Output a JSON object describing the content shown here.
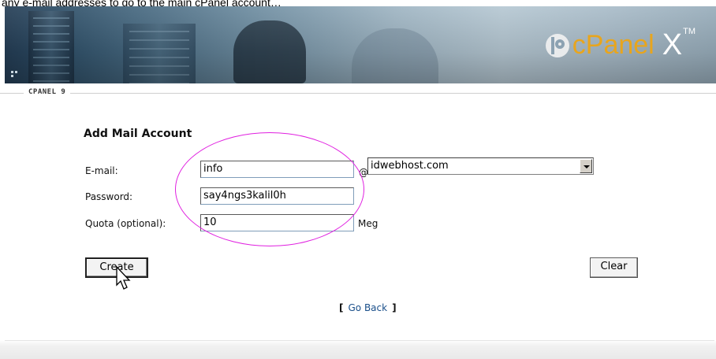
{
  "caption": "any e-mail addresses to go to the main cPanel account…",
  "banner": {
    "logo_text": "cPanel",
    "logo_suffix": "X",
    "logo_tm": "TM"
  },
  "breadcrumb": "CPANEL 9",
  "form": {
    "title": "Add Mail Account",
    "email_label": "E-mail:",
    "email_value": "info",
    "at_symbol": "@",
    "domain_value": "idwebhost.com",
    "password_label": "Password:",
    "password_value": "say4ngs3kalil0h",
    "quota_label": "Quota (optional):",
    "quota_value": "10",
    "quota_unit": "Meg"
  },
  "buttons": {
    "create": "Create",
    "clear": "Clear"
  },
  "links": {
    "go_back_open": "[",
    "go_back": "Go Back",
    "go_back_close": "]"
  },
  "annotation": {
    "ellipse_color": "#e020e0"
  },
  "colors": {
    "logo_orange": "#e8a51d",
    "link_blue": "#1a4f8a"
  },
  "icons": {
    "cursor": "mouse-pointer-icon",
    "dropdown": "chevron-down-icon"
  }
}
